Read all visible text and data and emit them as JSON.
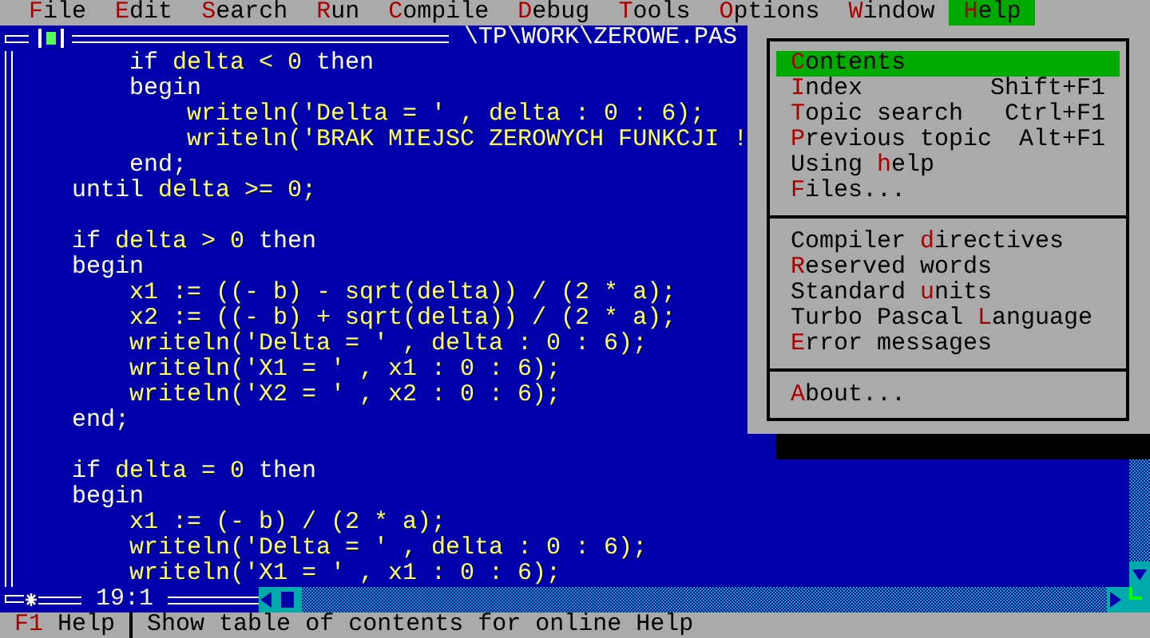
{
  "menu_bar": [
    {
      "key": "F",
      "post": "ile",
      "selected": false
    },
    {
      "key": "E",
      "post": "dit",
      "selected": false
    },
    {
      "key": "S",
      "post": "earch",
      "selected": false
    },
    {
      "key": "R",
      "post": "un",
      "selected": false
    },
    {
      "key": "C",
      "post": "ompile",
      "selected": false
    },
    {
      "key": "D",
      "post": "ebug",
      "selected": false
    },
    {
      "key": "T",
      "post": "ools",
      "selected": false
    },
    {
      "key": "O",
      "post": "ptions",
      "selected": false
    },
    {
      "key": "W",
      "post": "indow",
      "selected": false
    },
    {
      "key": "H",
      "post": "elp",
      "selected": true
    }
  ],
  "editor": {
    "title": "\\TP\\WORK\\ZEROWE.PAS",
    "cursor_position": "19:1",
    "lines": [
      {
        "kind": "code",
        "tokens": [
          {
            "text": "        if",
            "kind": "keyword"
          },
          {
            "text": " delta < 0 ",
            "kind": "ident"
          },
          {
            "text": "then",
            "kind": "keyword"
          }
        ]
      },
      {
        "kind": "code",
        "tokens": [
          {
            "text": "        begin",
            "kind": "keyword"
          }
        ]
      },
      {
        "kind": "code",
        "tokens": [
          {
            "text": "            writeln('Delta = ' , delta : 0 : 6);",
            "kind": "ident"
          }
        ]
      },
      {
        "kind": "code",
        "tokens": [
          {
            "text": "            writeln('BRAK MIEJSC ZEROWYCH FUNKCJI !",
            "kind": "ident"
          }
        ]
      },
      {
        "kind": "code",
        "tokens": [
          {
            "text": "        end;",
            "kind": "keyword"
          }
        ]
      },
      {
        "kind": "code",
        "tokens": [
          {
            "text": "    until",
            "kind": "keyword"
          },
          {
            "text": " delta >= 0;",
            "kind": "ident"
          }
        ]
      },
      {
        "kind": "blank"
      },
      {
        "kind": "code",
        "tokens": [
          {
            "text": "    if",
            "kind": "keyword"
          },
          {
            "text": " delta > 0 ",
            "kind": "ident"
          },
          {
            "text": "then",
            "kind": "keyword"
          }
        ]
      },
      {
        "kind": "code",
        "tokens": [
          {
            "text": "    begin",
            "kind": "keyword"
          }
        ]
      },
      {
        "kind": "code",
        "tokens": [
          {
            "text": "        x1 := ((- b) - sqrt(delta)) / (2 * a);",
            "kind": "ident"
          }
        ]
      },
      {
        "kind": "code",
        "tokens": [
          {
            "text": "        x2 := ((- b) + sqrt(delta)) / (2 * a);",
            "kind": "ident"
          }
        ]
      },
      {
        "kind": "code",
        "tokens": [
          {
            "text": "        writeln('Delta = ' , delta : 0 : 6);",
            "kind": "ident"
          }
        ]
      },
      {
        "kind": "code",
        "tokens": [
          {
            "text": "        writeln('X1 = ' , x1 : 0 : 6);",
            "kind": "ident"
          }
        ]
      },
      {
        "kind": "code",
        "tokens": [
          {
            "text": "        writeln('X2 = ' , x2 : 0 : 6);",
            "kind": "ident"
          }
        ]
      },
      {
        "kind": "code",
        "tokens": [
          {
            "text": "    end;",
            "kind": "keyword"
          }
        ]
      },
      {
        "kind": "blank"
      },
      {
        "kind": "code",
        "tokens": [
          {
            "text": "    if",
            "kind": "keyword"
          },
          {
            "text": " delta = 0 ",
            "kind": "ident"
          },
          {
            "text": "then",
            "kind": "keyword"
          }
        ]
      },
      {
        "kind": "code",
        "tokens": [
          {
            "text": "    begin",
            "kind": "keyword"
          }
        ]
      },
      {
        "kind": "code",
        "tokens": [
          {
            "text": "        x1 := (- b) / (2 * a);",
            "kind": "ident"
          }
        ]
      },
      {
        "kind": "code",
        "tokens": [
          {
            "text": "        writeln('Delta = ' , delta : 0 : 6);",
            "kind": "ident"
          }
        ]
      },
      {
        "kind": "code",
        "tokens": [
          {
            "text": "        writeln('X1 = ' , x1 : 0 : 6);",
            "kind": "ident"
          }
        ]
      }
    ]
  },
  "help_menu": [
    {
      "kind": "item",
      "key": "C",
      "post": "ontents",
      "selected": true
    },
    {
      "kind": "item",
      "key": "I",
      "post": "ndex",
      "shortcut": "Shift+F1",
      "selected": false
    },
    {
      "kind": "item",
      "key": "T",
      "post": "opic search",
      "shortcut": "Ctrl+F1",
      "selected": false
    },
    {
      "kind": "item",
      "key": "P",
      "post": "revious topic",
      "shortcut": "Alt+F1",
      "selected": false
    },
    {
      "kind": "item",
      "pre": "Using ",
      "key": "h",
      "post": "elp",
      "selected": false
    },
    {
      "kind": "item",
      "key": "F",
      "post": "iles...",
      "selected": false
    },
    {
      "kind": "separator"
    },
    {
      "kind": "item",
      "pre": "Compiler ",
      "key": "d",
      "post": "irectives",
      "selected": false
    },
    {
      "kind": "item",
      "key": "R",
      "post": "eserved words",
      "selected": false
    },
    {
      "kind": "item",
      "pre": "Standard ",
      "key": "u",
      "post": "nits",
      "selected": false
    },
    {
      "kind": "item",
      "pre": "Turbo Pascal ",
      "key": "L",
      "post": "anguage",
      "selected": false
    },
    {
      "kind": "item",
      "key": "E",
      "post": "rror messages",
      "selected": false
    },
    {
      "kind": "separator"
    },
    {
      "kind": "item",
      "key": "A",
      "post": "bout...",
      "selected": false
    }
  ],
  "status_bar": {
    "key": "F1",
    "label": "Help",
    "message": "Show table of contents for online Help"
  }
}
